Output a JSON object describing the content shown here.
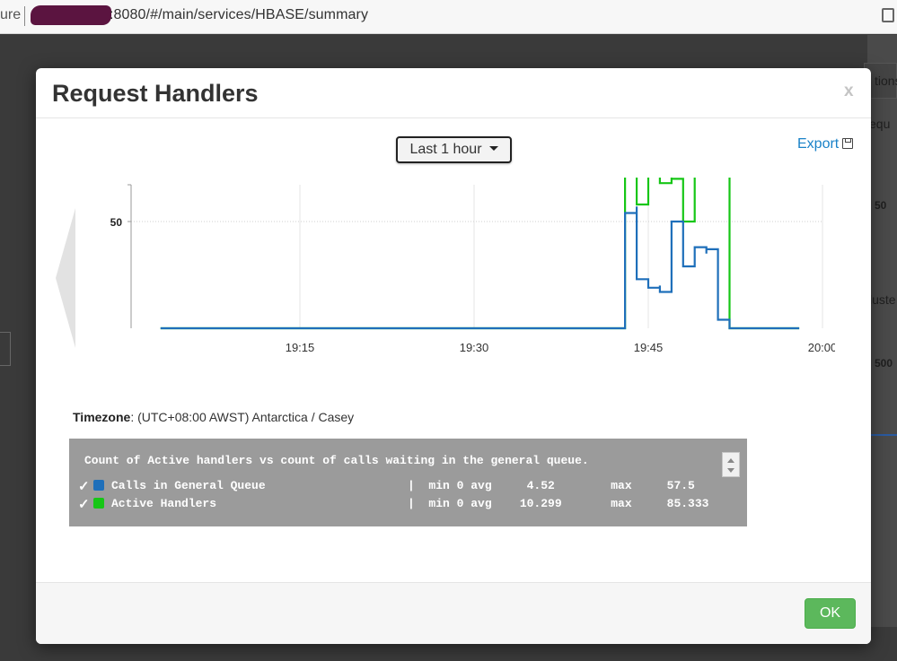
{
  "browser": {
    "address_prefix": "ure",
    "address_url": ":8080/#/main/services/HBASE/summary"
  },
  "background": {
    "right_labels": [
      "tions",
      "equ",
      "50",
      "luste",
      "500"
    ]
  },
  "modal": {
    "title": "Request Handlers",
    "close_label": "x",
    "time_range": "Last 1 hour",
    "export_label": "Export",
    "timezone_label": "Timezone",
    "timezone_value": ": (UTC+08:00 AWST) Antarctica / Casey",
    "ok_label": "OK"
  },
  "legend": {
    "caption": "Count of Active handlers vs count of calls waiting in the general queue.",
    "rows": [
      {
        "check": "✓",
        "name": "Calls in General Queue",
        "stats": "|  min 0 avg     4.52        max     57.5",
        "color": "#1e6fba"
      },
      {
        "check": "✓",
        "name": "Active Handlers",
        "stats": "|  min 0 avg    10.299       max     85.333",
        "color": "#16c616"
      }
    ]
  },
  "chart_data": {
    "type": "line",
    "x_unit": "time (HH:MM)",
    "x_ticks": [
      "19:15",
      "19:30",
      "19:45",
      "20:00"
    ],
    "y_ticks": [
      50
    ],
    "grid": true,
    "series": [
      {
        "name": "Calls in General Queue",
        "color": "#1e6fba",
        "points": [
          [
            "19:03",
            0
          ],
          [
            "19:43",
            0
          ],
          [
            "19:43",
            54
          ],
          [
            "19:44",
            57
          ],
          [
            "19:44",
            23
          ],
          [
            "19:45",
            19
          ],
          [
            "19:46",
            20
          ],
          [
            "19:46",
            17
          ],
          [
            "19:47",
            50
          ],
          [
            "19:48",
            29
          ],
          [
            "19:49",
            38
          ],
          [
            "19:50",
            35
          ],
          [
            "19:50",
            37
          ],
          [
            "19:51",
            28
          ],
          [
            "19:51",
            4
          ],
          [
            "19:52",
            0
          ],
          [
            "19:58",
            0
          ]
        ]
      },
      {
        "name": "Active Handlers",
        "color": "#16c616",
        "points": [
          [
            "19:03",
            0
          ],
          [
            "19:43",
            0
          ],
          [
            "19:43",
            73
          ],
          [
            "19:44",
            80
          ],
          [
            "19:44",
            58
          ],
          [
            "19:45",
            74
          ],
          [
            "19:46",
            68
          ],
          [
            "19:47",
            75
          ],
          [
            "19:47",
            70
          ],
          [
            "19:48",
            50
          ],
          [
            "19:49",
            86
          ],
          [
            "19:50",
            73
          ],
          [
            "19:51",
            84
          ],
          [
            "19:51",
            73
          ],
          [
            "19:52",
            0
          ],
          [
            "19:58",
            0
          ]
        ]
      }
    ]
  }
}
